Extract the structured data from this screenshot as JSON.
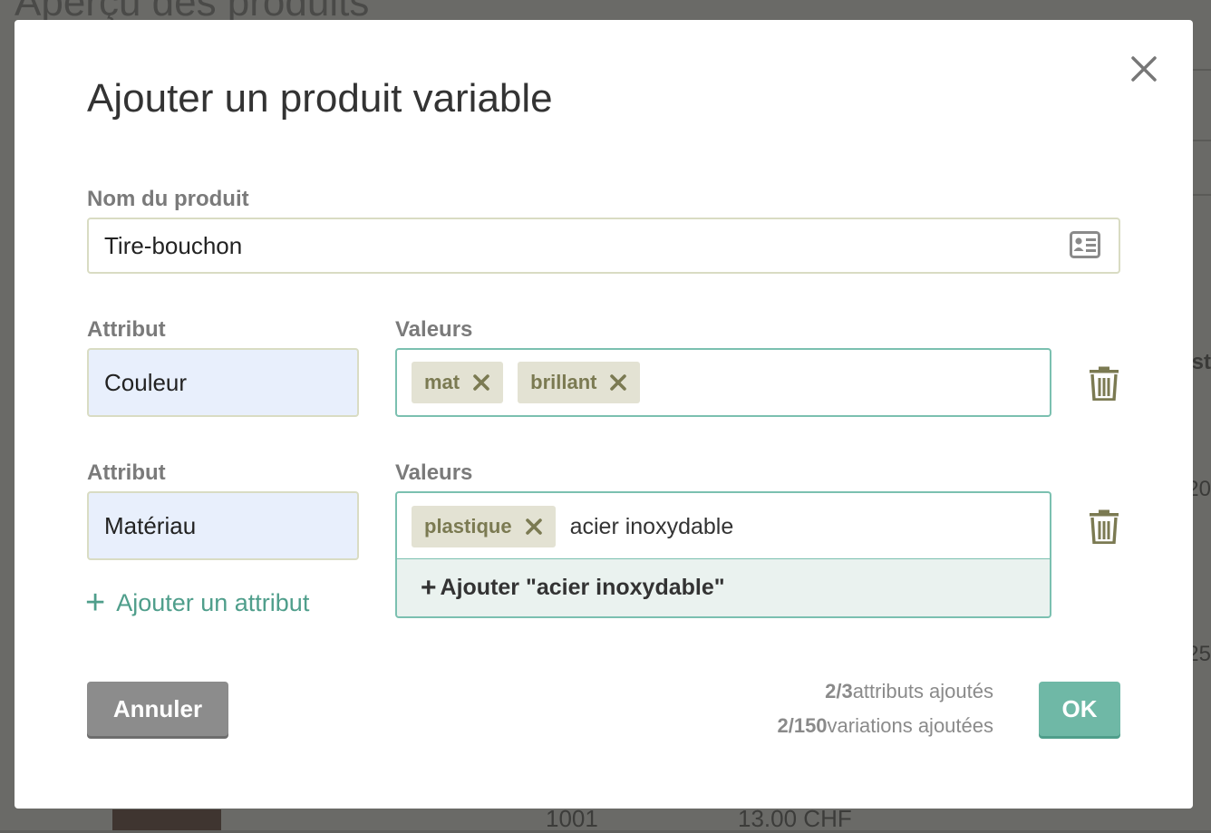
{
  "background": {
    "page_title": "Aperçu des produits",
    "edge_text_1": "st",
    "edge_text_2": "20",
    "edge_text_3": "25",
    "cell_id": "1001",
    "cell_price": "13.00 CHF"
  },
  "modal": {
    "title": "Ajouter un produit variable",
    "product_name_label": "Nom du produit",
    "product_name_value": "Tire-bouchon",
    "attributes": [
      {
        "attribute_label": "Attribut",
        "attribute_value": "Couleur",
        "values_label": "Valeurs",
        "tags": [
          "mat",
          "brillant"
        ],
        "typed": ""
      },
      {
        "attribute_label": "Attribut",
        "attribute_value": "Matériau",
        "values_label": "Valeurs",
        "tags": [
          "plastique"
        ],
        "typed": "acier inoxydable"
      }
    ],
    "dropdown_suggestion": "Ajouter \"acier inoxydable\"",
    "add_attribute_label": "Ajouter un attribut",
    "cancel_label": "Annuler",
    "ok_label": "OK",
    "attributes_count": "2/3",
    "attributes_suffix": "attributs ajoutés",
    "variations_count": "2/150",
    "variations_suffix": "variations ajoutées"
  },
  "colors": {
    "accent": "#6fb8a6",
    "accent_text": "#4f9e8b",
    "tag_bg": "#e3e2d3",
    "tag_text": "#7b7a52",
    "attr_input_bg": "#e8effc",
    "cancel_bg": "#8c8c8c"
  },
  "icons": {
    "close": "close-icon",
    "name_field": "contact-card-icon",
    "delete": "trash-icon",
    "remove_tag": "close-small-icon",
    "add": "plus-icon"
  }
}
